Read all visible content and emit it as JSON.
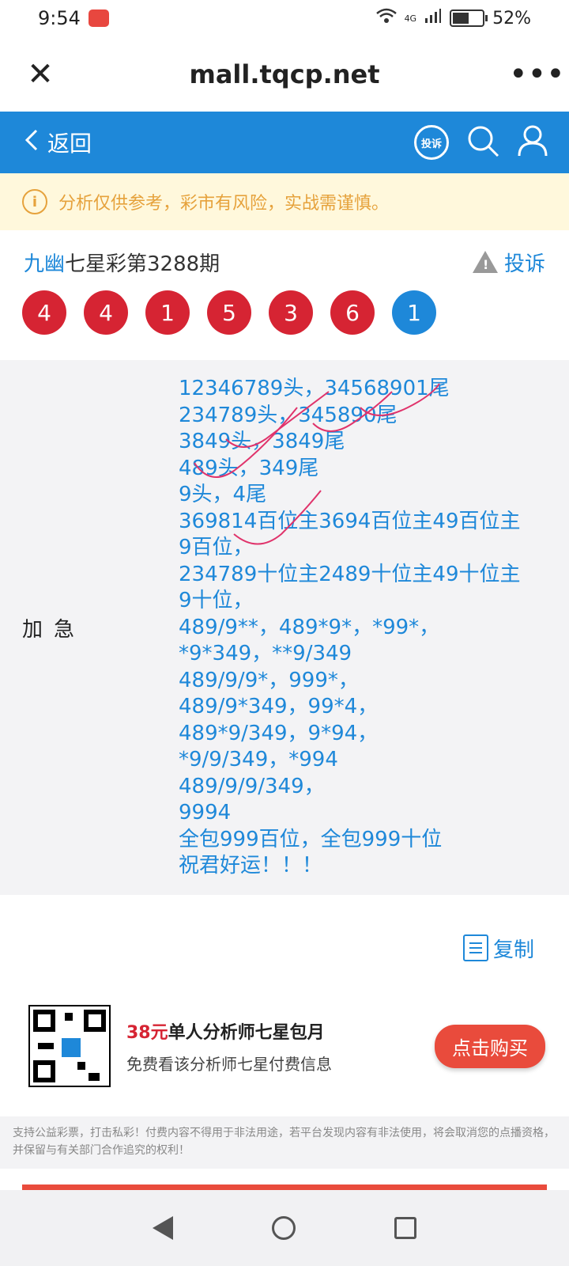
{
  "status": {
    "time": "9:54",
    "network": "4G",
    "battery": "52%"
  },
  "browser": {
    "url": "mall.tqcp.net",
    "close": "✕",
    "more": "•••"
  },
  "header": {
    "back_label": "返回",
    "complain_label": "投诉"
  },
  "notice": {
    "text": "分析仅供参考，彩市有风险，实战需谨慎。"
  },
  "post": {
    "author": "九幽",
    "title": "七星彩第3288期",
    "report_label": "投诉",
    "balls": [
      "4",
      "4",
      "1",
      "5",
      "3",
      "6",
      "1"
    ],
    "label": "加急",
    "lines": [
      "12346789头，34568901尾",
      "234789头，345890尾",
      "3849头，3849尾",
      "489头，349尾",
      "9头，4尾",
      "369814百位主3694百位主49百位主",
      "9百位，",
      "234789十位主2489十位主49十位主",
      "9十位，",
      "489/9**，489*9*，*99*，",
      "*9*349，**9/349",
      "489/9/9*，999*，",
      "489/9*349，99*4，",
      "489*9/349，9*94，",
      "*9/9/349，*994",
      "489/9/9/349，",
      "9994",
      "全包999百位，全包999十位",
      "祝君好运！！！"
    ]
  },
  "copy": {
    "label": "复制"
  },
  "promo": {
    "price": "38元",
    "title": "单人分析师七星包月",
    "subtitle": "免费看该分析师七星付费信息",
    "button": "点击购买"
  },
  "disclaimer": "支持公益彩票，打击私彩！付费内容不得用于非法用途，若平台发现内容有非法使用，将会取消您的点播资格，并保留与有关部门合作追究的权利！"
}
